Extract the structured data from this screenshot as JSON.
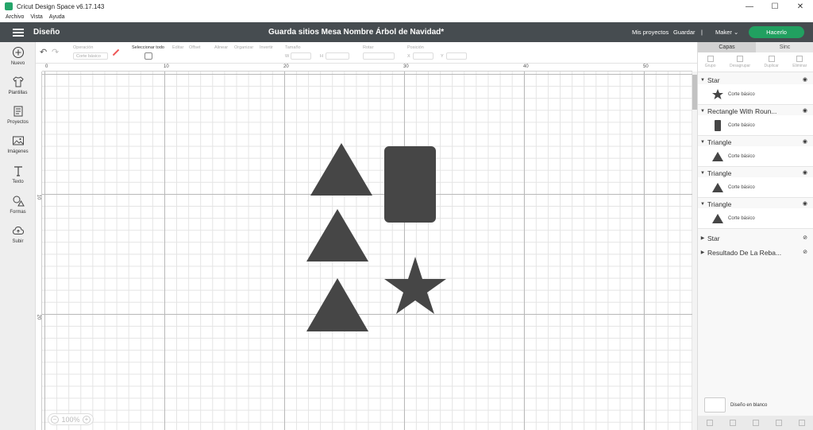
{
  "window": {
    "title": "Cricut Design Space  v6.17.143",
    "minimize": "—",
    "maximize": "☐",
    "close": "✕"
  },
  "menu": [
    "Archivo",
    "Vista",
    "Ayuda"
  ],
  "header": {
    "section": "Diseño",
    "project_title": "Guarda sitios Mesa Nombre Árbol de Navidad*",
    "my_projects": "Mis proyectos",
    "save": "Guardar",
    "separator": "|",
    "machine": "Maker",
    "make_it": "Hacerlo",
    "bg_color": "#464c50",
    "accent": "#21a060"
  },
  "left_tools": [
    {
      "label": "Nuevo",
      "icon": "plus-circle-icon"
    },
    {
      "label": "Plantillas",
      "icon": "shirt-icon"
    },
    {
      "label": "Proyectos",
      "icon": "book-icon"
    },
    {
      "label": "Imágenes",
      "icon": "image-icon"
    },
    {
      "label": "Texto",
      "icon": "text-icon"
    },
    {
      "label": "Formas",
      "icon": "shapes-icon"
    },
    {
      "label": "Subir",
      "icon": "upload-cloud-icon"
    }
  ],
  "edit_toolbar": {
    "operation_label": "Operación",
    "operation_value": "Corte básico",
    "select_all": "Seleccionar todo",
    "edit": "Editar",
    "offset": "Offset",
    "align": "Alinear",
    "arrange": "Organizar",
    "flip": "Invertir",
    "size": "Tamaño",
    "size_w": "W",
    "size_h": "H",
    "rotate": "Rotar",
    "position": "Posición",
    "pos_x": "X",
    "pos_y": "Y"
  },
  "ruler": {
    "top": [
      "0",
      "10",
      "20",
      "30",
      "40",
      "50"
    ],
    "left": [
      "10",
      "20"
    ]
  },
  "zoom": {
    "value": "100%",
    "minus": "−",
    "plus": "+"
  },
  "panel": {
    "tabs": [
      "Capas",
      "Sinc"
    ],
    "layer_tools": [
      "Grupo",
      "Desagrupar",
      "Duplicar",
      "Eliminar"
    ],
    "layers": [
      {
        "name": "Star",
        "sub": "Corte básico",
        "expanded": true,
        "visible": true,
        "shape": "star"
      },
      {
        "name": "Rectangle With Roun...",
        "sub": "Corte básico",
        "expanded": true,
        "visible": true,
        "shape": "rect"
      },
      {
        "name": "Triangle",
        "sub": "Corte básico",
        "expanded": true,
        "visible": true,
        "shape": "triangle"
      },
      {
        "name": "Triangle",
        "sub": "Corte básico",
        "expanded": true,
        "visible": true,
        "shape": "triangle"
      },
      {
        "name": "Triangle",
        "sub": "Corte básico",
        "expanded": true,
        "visible": true,
        "shape": "triangle"
      },
      {
        "name": "Star",
        "expanded": false,
        "visible": false
      },
      {
        "name": "Resultado De La Reba...",
        "expanded": false,
        "visible": false
      }
    ],
    "blank_canvas": "Diseño en blanco"
  },
  "shape_color": "#464646"
}
